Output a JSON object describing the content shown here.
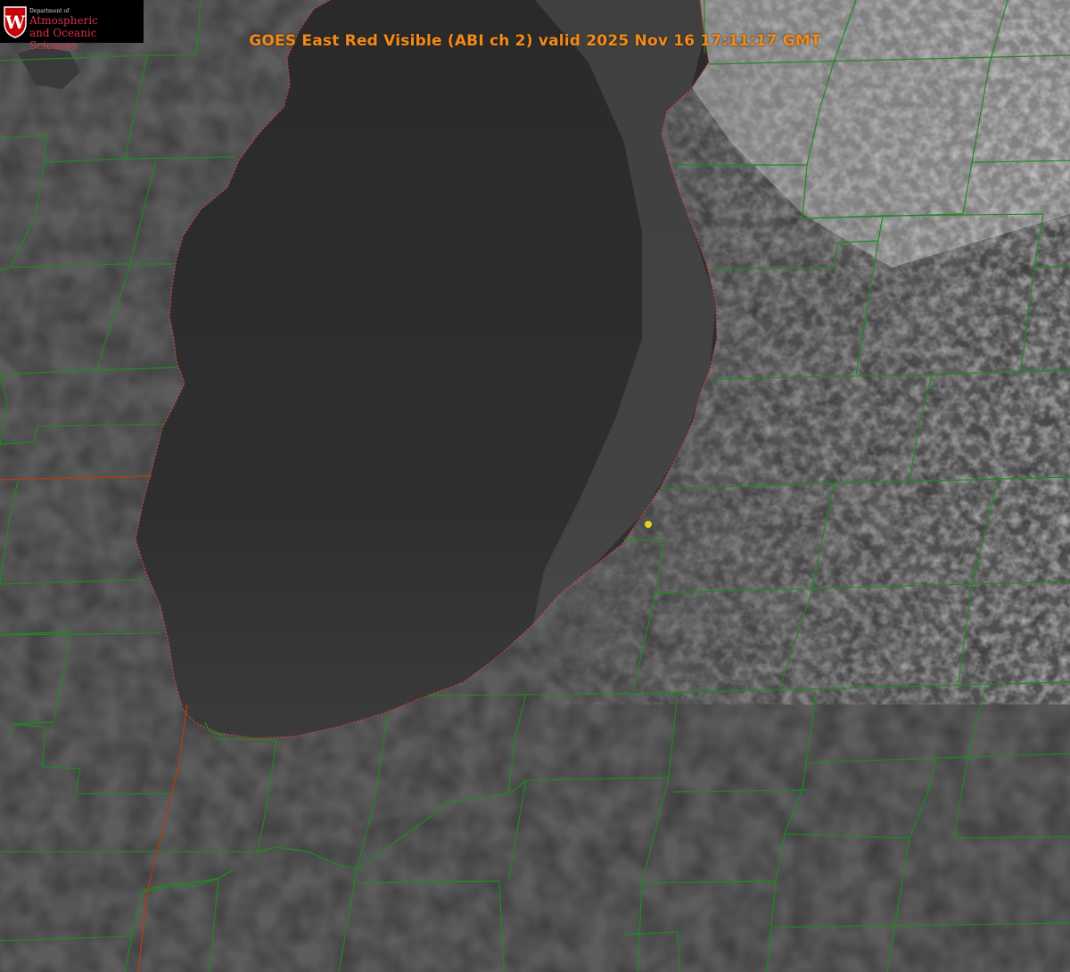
{
  "title": "GOES East Red Visible (ABI ch 2) valid 2025 Nov 16 17:11:17 GMT",
  "logo": {
    "department": "Department of",
    "line1": "Atmospheric",
    "line2": "and Oceanic Sciences",
    "crest_letter": "W",
    "crest_color": "#c5050c"
  },
  "colors": {
    "land": "#5c5c5c",
    "lake": "#2e2e2e",
    "county_lines": "#1f8a1f",
    "state_line": "#b03a1a",
    "shoreline_dots": "#d04040",
    "marker": "#e6d21a",
    "title": "#f08a1c"
  },
  "marker": {
    "icon": "station-dot-icon"
  }
}
